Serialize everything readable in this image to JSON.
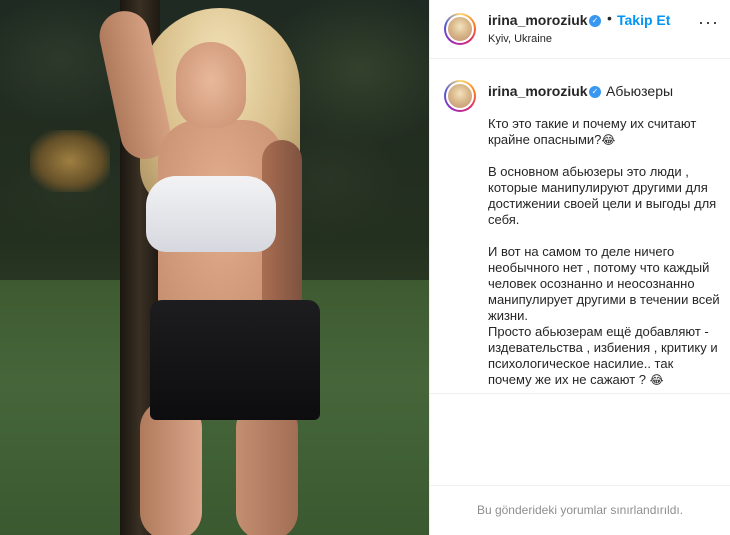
{
  "post": {
    "username": "irina_moroziuk",
    "follow_label": "Takip Et",
    "location": "Kyiv, Ukraine",
    "more_icon": "ellipsis-icon"
  },
  "caption": {
    "username": "irina_moroziuk",
    "title": "Абьюзеры",
    "body_p1": "Кто это такие и почему их считают крайне опасными?",
    "body_p2": "В основном абьюзеры это люди , которые манипулируют другими для достижении своей цели и выгоды для себя.",
    "body_p3": "И вот на самом то деле ничего необычного нет , потому что каждый человек осознанно и неосознанно манипулирует другими в течении всей жизни.",
    "body_p4": "Просто абьюзерам ещё добавляют - издевательства , избиения , критику и психологическое насилие.. так почему же их не сажают ?",
    "emoji": "😂"
  },
  "comments": {
    "restricted_text": "Bu gönderideki yorumlar sınırlandırıldı."
  },
  "colors": {
    "follow": "#0095f6",
    "verified": "#3897f0",
    "muted_text": "#8e8e8e"
  }
}
